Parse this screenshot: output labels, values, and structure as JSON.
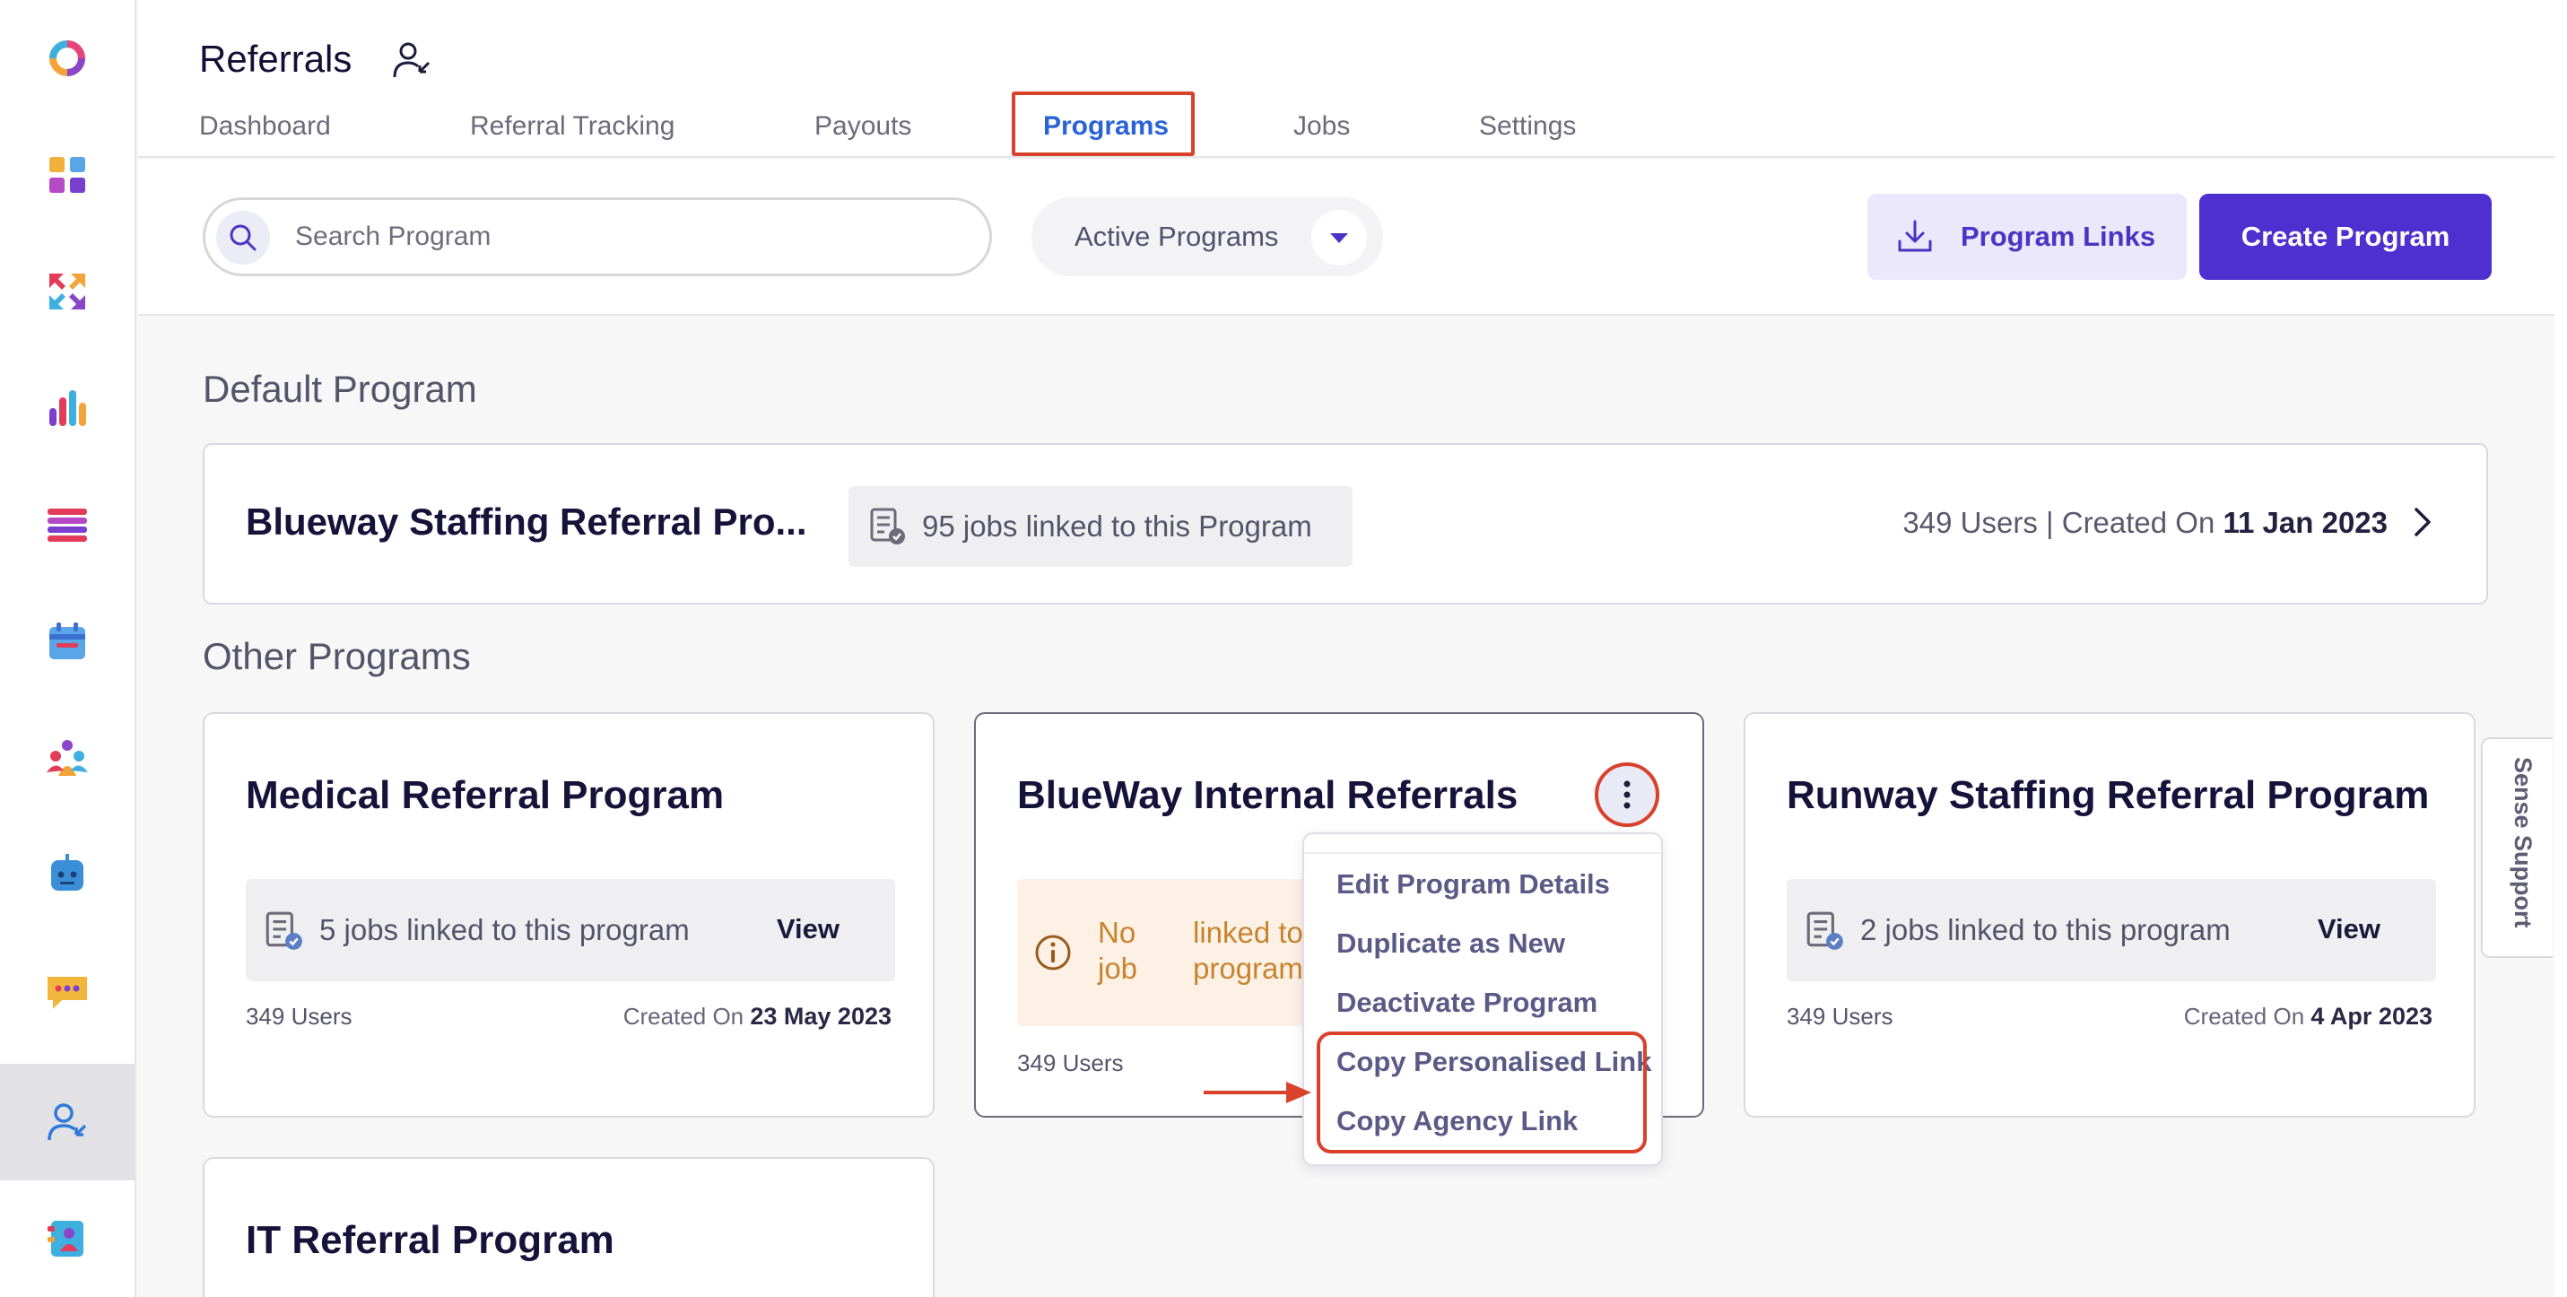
{
  "app": {
    "title": "Referrals"
  },
  "rail": {
    "icons": [
      "app-logo-icon",
      "dashboard-grid-icon",
      "arrows-exchange-icon",
      "analytics-bars-icon",
      "list-icon",
      "calendar-icon",
      "team-icon",
      "chatbot-icon",
      "messages-icon",
      "referrals-icon",
      "contacts-icon"
    ],
    "active": "referrals-icon"
  },
  "tabs": [
    {
      "label": "Dashboard"
    },
    {
      "label": "Referral Tracking"
    },
    {
      "label": "Payouts"
    },
    {
      "label": "Programs",
      "active": true
    },
    {
      "label": "Jobs"
    },
    {
      "label": "Settings"
    }
  ],
  "toolbar": {
    "search_placeholder": "Search Program",
    "filter_label": "Active Programs",
    "program_links_label": "Program Links",
    "create_label": "Create Program"
  },
  "default_section": {
    "heading": "Default Program",
    "program": {
      "title": "Blueway Staffing Referral Pro...",
      "jobs": "95 jobs linked to this Program",
      "meta_prefix": "349 Users | Created On ",
      "date": "11 Jan 2023"
    }
  },
  "other_section": {
    "heading": "Other Programs",
    "programs": [
      {
        "title": "Medical Referral Program",
        "jobs": "5 jobs linked to this program",
        "view": "View",
        "users": "349 Users",
        "created_label": "Created On ",
        "date": "23 May 2023"
      },
      {
        "title": "BlueWay Internal Referrals",
        "warn_line1a": "No",
        "warn_line1b": "linked to",
        "warn_line2a": "job",
        "warn_line2b": "program",
        "users": "349 Users"
      },
      {
        "title": "Runway Staffing Referral Program",
        "jobs": "2 jobs linked to this program",
        "view": "View",
        "users": "349 Users",
        "created_label": "Created On ",
        "date": "4 Apr 2023"
      },
      {
        "title": "IT Referral Program"
      }
    ]
  },
  "context_menu": {
    "items": [
      {
        "label": "Edit Program Details"
      },
      {
        "label": "Duplicate as New"
      },
      {
        "label": "Deactivate Program"
      },
      {
        "label": "Copy Personalised Link"
      },
      {
        "label": "Copy Agency Link"
      }
    ]
  },
  "support": {
    "label": "Sense Support"
  },
  "colors": {
    "accent": "#4e2fcf",
    "active_tab": "#2a62d8",
    "highlight": "#d9412b",
    "warning": "#c8832e"
  }
}
